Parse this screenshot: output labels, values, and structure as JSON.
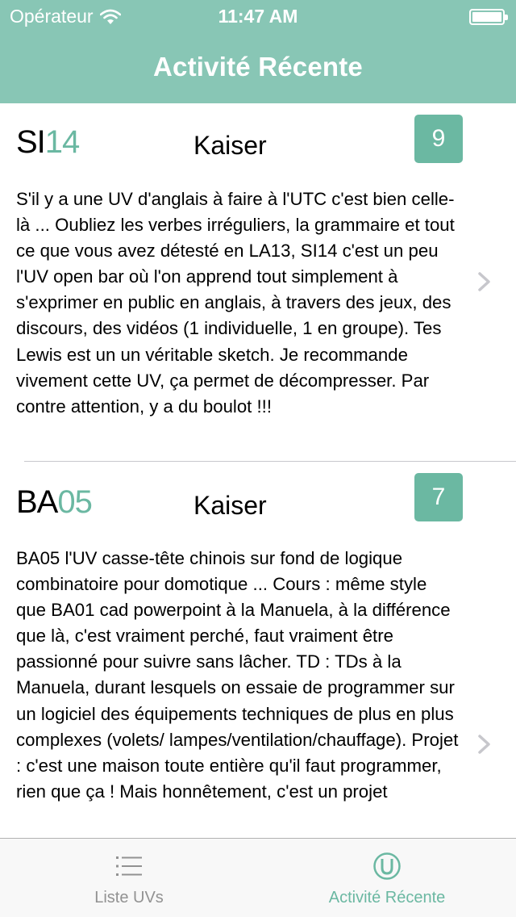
{
  "status_bar": {
    "carrier": "Opérateur",
    "time": "11:47 AM"
  },
  "nav": {
    "title": "Activité Récente"
  },
  "reviews": [
    {
      "code_prefix": "SI",
      "code_number": "14",
      "teacher": "Kaiser",
      "rating": "9",
      "text": "S'il y a une UV d'anglais à faire à l'UTC c'est bien celle-là ... Oubliez les verbes irréguliers, la grammaire et tout ce que vous avez détesté en LA13, SI14 c'est un peu l'UV open bar où l'on apprend tout simplement à s'exprimer en public en anglais, à travers des jeux, des discours, des vidéos (1 individuelle, 1 en groupe). Tes Lewis est un un véritable sketch. Je recommande vivement cette UV, ça permet de décompresser. Par contre attention, y a du boulot !!!"
    },
    {
      "code_prefix": "BA",
      "code_number": "05",
      "teacher": "Kaiser",
      "rating": "7",
      "text": "BA05 l'UV casse-tête chinois sur fond de logique combinatoire pour domotique ... Cours : même style que BA01 cad powerpoint à la Manuela, à la différence que là, c'est vraiment perché, faut vraiment être passionné pour suivre sans lâcher. TD : TDs à la Manuela, durant lesquels on essaie de programmer sur un logiciel des équipements techniques de plus en plus complexes (volets/ lampes/ventilation/chauffage). Projet : c'est une maison toute entière qu'il faut programmer, rien que ça ! Mais honnêtement, c'est un projet"
    }
  ],
  "tab_bar": {
    "tabs": [
      {
        "label": "Liste UVs",
        "icon": "list-icon",
        "selected": false
      },
      {
        "label": "Activité Récente",
        "icon": "utc-logo-icon",
        "selected": true
      }
    ]
  },
  "colors": {
    "header_bg": "#88c6b5",
    "accent": "#6bb8a2",
    "tab_inactive": "#929292"
  }
}
